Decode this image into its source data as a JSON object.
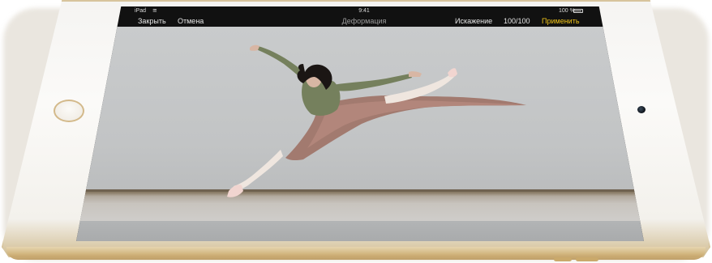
{
  "status_bar": {
    "carrier": "iPad",
    "wifi_icon": "wifi-icon",
    "time": "9:41",
    "battery_percent": "100 %",
    "battery_icon": "battery-icon",
    "battery_level": 1.0
  },
  "toolbar": {
    "close_label": "Закрыть",
    "cancel_label": "Отмена",
    "title": "Деформация",
    "distortion_label": "Искажение",
    "level_value": "100/100",
    "apply_label": "Применить"
  },
  "colors": {
    "accent": "#f0c419",
    "toolbar_text": "#e6e6e6",
    "title_text": "#9d9d9d",
    "device_gold": "#d2b57d"
  }
}
